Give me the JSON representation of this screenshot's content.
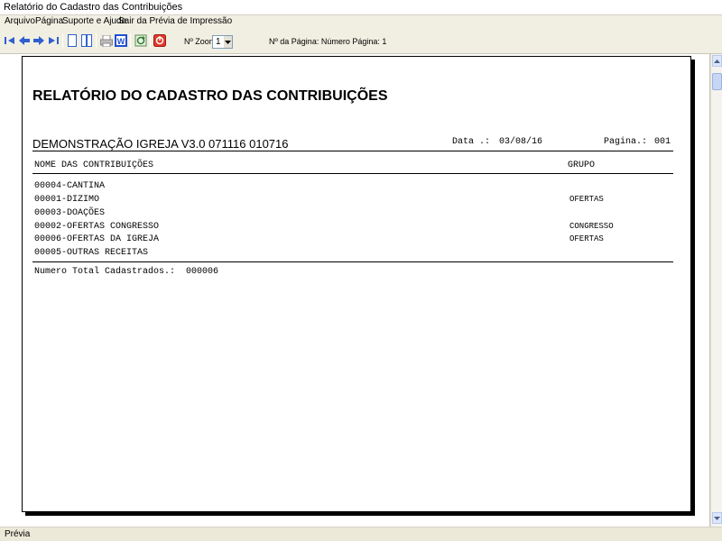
{
  "window": {
    "title": "Relatório do Cadastro das Contribuições"
  },
  "menu": {
    "arquivo": "Arquivo",
    "pagina": "Página",
    "suporte": "Suporte e Ajuda",
    "sair": "Sair da Prévia de Impressão"
  },
  "toolbar": {
    "zoom_label": "Nº Zoom",
    "zoom_value": "1",
    "page_info": "Nº da Página: Número Página: 1",
    "icons": [
      "first-page-icon",
      "previous-page-icon",
      "next-page-icon",
      "last-page-icon",
      "single-page-icon",
      "two-pages-icon",
      "print-icon",
      "word-export-icon",
      "refresh-icon",
      "stop-icon"
    ]
  },
  "report": {
    "title": "RELATÓRIO DO CADASTRO DAS CONTRIBUIÇÕES",
    "company": "DEMONSTRAÇÃO IGREJA V3.0 071116 010716",
    "date_label": "Data .:",
    "date": "03/08/16",
    "page_label": "Pagina.:",
    "page": "001",
    "col_name": "NOME DAS CONTRIBUIÇÕES",
    "col_group": "GRUPO",
    "rows": [
      {
        "name": "00004-CANTINA",
        "group": ""
      },
      {
        "name": "00001-DIZIMO",
        "group": "OFERTAS"
      },
      {
        "name": "00003-DOAÇÕES",
        "group": ""
      },
      {
        "name": "00002-OFERTAS CONGRESSO",
        "group": "CONGRESSO"
      },
      {
        "name": "00006-OFERTAS DA IGREJA",
        "group": "OFERTAS"
      },
      {
        "name": "00005-OUTRAS RECEITAS",
        "group": ""
      }
    ],
    "total_label": "Numero Total Cadastrados.:",
    "total": "000006"
  },
  "status": {
    "text": "Prévia"
  },
  "colors": {
    "page_bg": "#ffffff",
    "chrome_bg": "#ece9d8",
    "toolbar_bg": "#f1efe2",
    "accent": "#1f4fd1"
  }
}
